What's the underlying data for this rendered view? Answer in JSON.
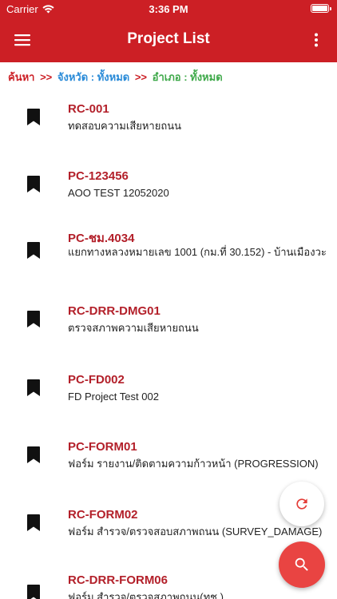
{
  "status_bar": {
    "carrier": "Carrier",
    "time": "3:36 PM"
  },
  "app_bar": {
    "title": "Project List"
  },
  "breadcrumb": {
    "search": "ค้นหา",
    "sep1": ">>",
    "province": "จังหวัด : ทั้งหมด",
    "sep2": ">>",
    "district": "อำเภอ : ทั้งหมด"
  },
  "projects": [
    {
      "code": "RC-001",
      "description": "ทดสอบความเสียหายถนน"
    },
    {
      "code": "PC-123456",
      "description": "AOO TEST 12052020"
    },
    {
      "code": "PC-ชม.4034",
      "description": "แยกทางหลวงหมายเลข 1001 (กม.ที่ 30.152) - บ้านเมืองวะ"
    },
    {
      "code": "RC-DRR-DMG01",
      "description": "ตรวจสภาพความเสียหายถนน"
    },
    {
      "code": "PC-FD002",
      "description": "FD Project Test 002"
    },
    {
      "code": "PC-FORM01",
      "description": "ฟอร์ม รายงาน/ติดตามความก้าวหน้า (PROGRESSION)"
    },
    {
      "code": "RC-FORM02",
      "description": "ฟอร์ม สำรวจ/ตรวจสอบสภาพถนน (SURVEY_DAMAGE)"
    },
    {
      "code": "RC-DRR-FORM06",
      "description": "ฟอร์ม สำรวจ/ตรวจสภาพถนน(ทช.)"
    }
  ],
  "colors": {
    "primary": "#cc1f25",
    "code_text": "#b3202a",
    "province_text": "#2a8bd8",
    "district_text": "#3fa94a",
    "fab_search": "#e94442"
  },
  "icons": {
    "menu": "hamburger-icon",
    "more": "more-vertical-icon",
    "item": "bookmark-icon",
    "refresh": "refresh-icon",
    "search": "search-icon"
  }
}
